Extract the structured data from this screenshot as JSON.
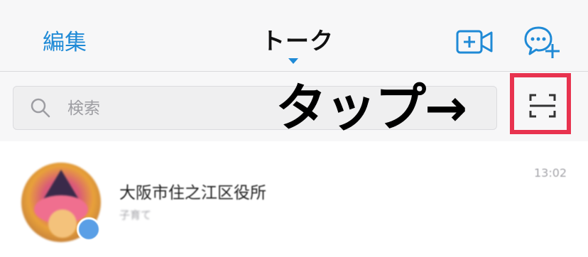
{
  "header": {
    "edit_label": "編集",
    "title": "トーク",
    "video_icon": "video-call-plus-icon",
    "newchat_icon": "new-chat-icon"
  },
  "search": {
    "placeholder": "検索",
    "value": "",
    "icon": "search-icon"
  },
  "annotation": {
    "text": "タップ→",
    "highlight_color": "#e8334f"
  },
  "scan": {
    "icon": "qr-scan-icon"
  },
  "chats": [
    {
      "name": "大阪市住之江区役所",
      "preview": "子育て",
      "time": "13:02",
      "avatar": "avatar",
      "badge": "official-badge-icon"
    }
  ],
  "colors": {
    "accent": "#1f8ad6",
    "header_bg": "#f7f7f8",
    "highlight": "#e8334f"
  }
}
